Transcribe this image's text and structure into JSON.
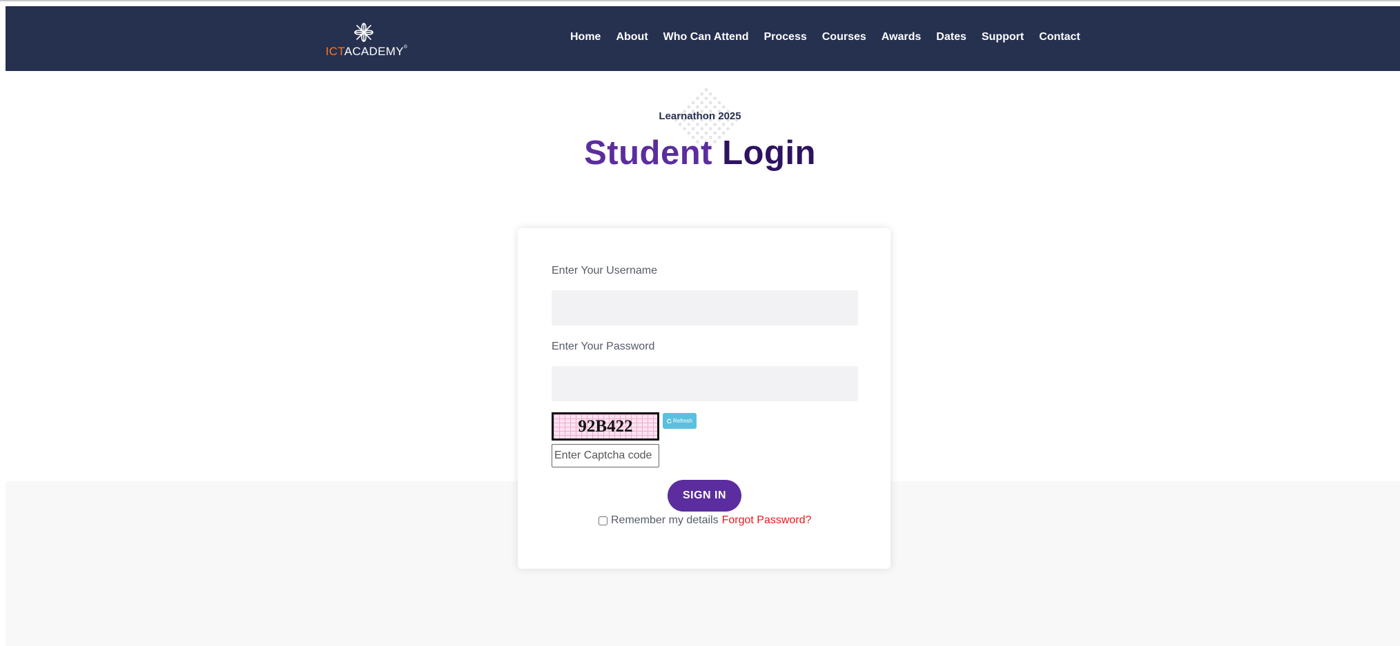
{
  "header": {
    "logo": {
      "part1": "ICT",
      "part2": "ACADEMY",
      "mark": "®"
    },
    "nav": [
      "Home",
      "About",
      "Who Can Attend",
      "Process",
      "Courses",
      "Awards",
      "Dates",
      "Support",
      "Contact"
    ]
  },
  "hero": {
    "subtitle": "Learnathon 2025",
    "title_part1": "Student",
    "title_part2": "Login"
  },
  "form": {
    "username_label": "Enter Your Username",
    "password_label": "Enter Your Password",
    "captcha_code": "92B422",
    "refresh_label": "Refresh",
    "captcha_placeholder": "Enter Captcha code",
    "signin_label": "SIGN IN",
    "remember_label": "Remember my details",
    "forgot_label": "Forgot Password?"
  },
  "colors": {
    "navbar": "#26304f",
    "brand_orange": "#f07c2b",
    "primary_purple": "#5b2d9e",
    "dark_purple": "#2d1360",
    "link_red": "#e8191c",
    "refresh_blue": "#5bc0de"
  },
  "icons": [
    "ictacademy-logo-icon",
    "refresh-icon",
    "dot-pattern-decoration"
  ]
}
